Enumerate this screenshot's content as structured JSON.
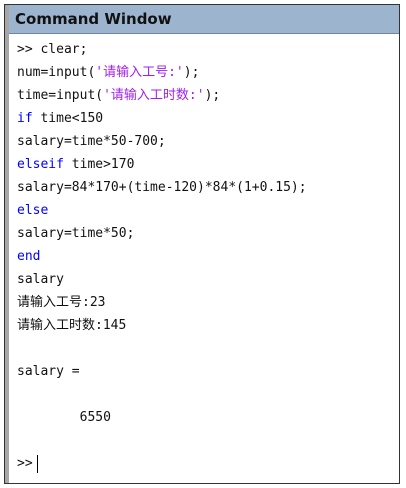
{
  "window": {
    "title": "Command Window"
  },
  "colors": {
    "keyword": "#0000ff",
    "string": "#a020f0",
    "titlebar": "#9db4cf"
  },
  "lines": [
    [
      {
        "t": ">> clear;",
        "c": ""
      }
    ],
    [
      {
        "t": "num=input(",
        "c": ""
      },
      {
        "t": "'请输入工号:'",
        "c": "str"
      },
      {
        "t": ");",
        "c": ""
      }
    ],
    [
      {
        "t": "time=input(",
        "c": ""
      },
      {
        "t": "'请输入工时数:'",
        "c": "str"
      },
      {
        "t": ");",
        "c": ""
      }
    ],
    [
      {
        "t": "if",
        "c": "kw"
      },
      {
        "t": " time<150",
        "c": ""
      }
    ],
    [
      {
        "t": "salary=time*50-700;",
        "c": ""
      }
    ],
    [
      {
        "t": "elseif",
        "c": "kw"
      },
      {
        "t": " time>170",
        "c": ""
      }
    ],
    [
      {
        "t": "salary=84*170+(time-120)*84*(1+0.15);",
        "c": ""
      }
    ],
    [
      {
        "t": "else",
        "c": "kw"
      }
    ],
    [
      {
        "t": "salary=time*50;",
        "c": ""
      }
    ],
    [
      {
        "t": "end",
        "c": "kw"
      }
    ],
    [
      {
        "t": "salary",
        "c": ""
      }
    ],
    [
      {
        "t": "请输入工号:23",
        "c": ""
      }
    ],
    [
      {
        "t": "请输入工时数:145",
        "c": ""
      }
    ],
    [],
    [
      {
        "t": "salary =",
        "c": ""
      }
    ],
    [],
    [
      {
        "t": "        6550",
        "c": ""
      }
    ],
    []
  ],
  "prompt": ">>"
}
